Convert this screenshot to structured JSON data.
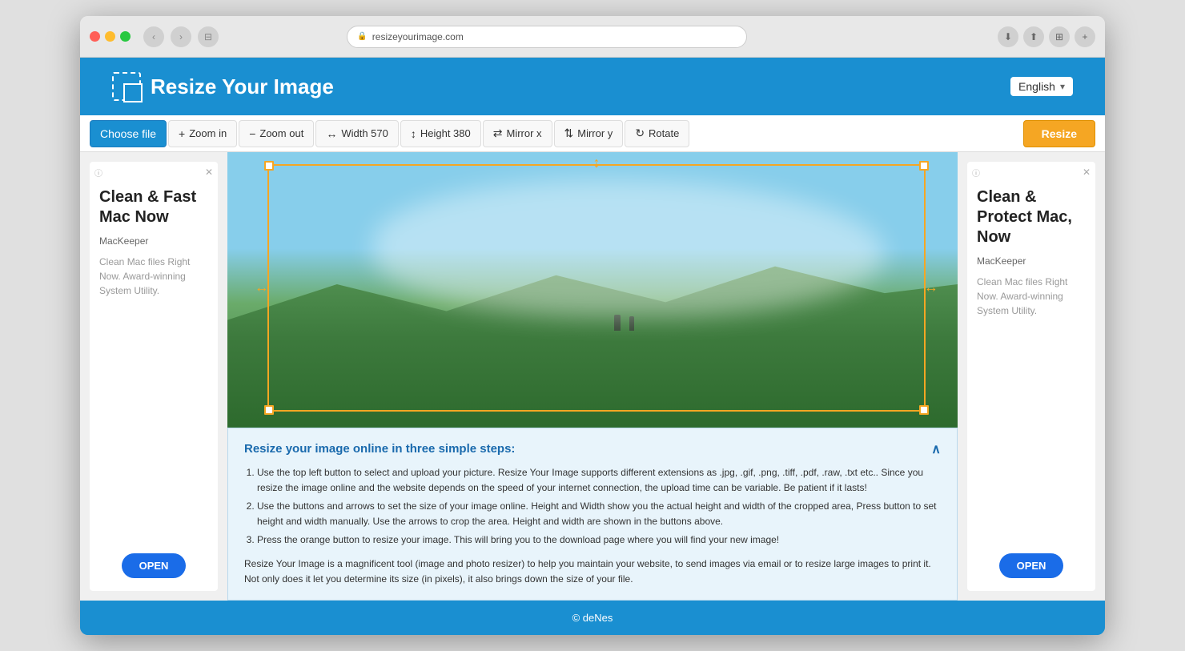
{
  "browser": {
    "url": "resizeyourimage.com",
    "reload_title": "↺"
  },
  "header": {
    "title": "Resize Your Image",
    "lang": "English"
  },
  "toolbar": {
    "choose_label": "Choose file",
    "zoom_in_label": "Zoom in",
    "zoom_out_label": "Zoom out",
    "width_label": "Width 570",
    "height_label": "Height 380",
    "mirror_x_label": "Mirror x",
    "mirror_y_label": "Mirror y",
    "rotate_label": "Rotate",
    "resize_label": "Resize"
  },
  "ad_left": {
    "heading": "Clean & Fast Mac Now",
    "brand": "MacKeeper",
    "desc": "Clean Mac files Right Now. Award-winning System Utility.",
    "open_btn": "OPEN"
  },
  "ad_right": {
    "heading": "Clean & Protect Mac, Now",
    "brand": "MacKeeper",
    "desc": "Clean Mac files Right Now. Award-winning System Utility.",
    "open_btn": "OPEN"
  },
  "info": {
    "title": "Resize your image online in three simple steps:",
    "steps": [
      "Use the top left button to select and upload your picture. Resize Your Image supports different extensions as .jpg, .gif, .png, .tiff, .pdf, .raw, .txt etc.. Since you resize the image online and the website depends on the speed of your internet connection, the upload time can be variable. Be patient if it lasts!",
      "Use the buttons and arrows to set the size of your image online. Height and Width show you the actual height and width of the cropped area, Press button to set height and width manually. Use the arrows to crop the area. Height and width are shown in the buttons above.",
      "Press the orange button to resize your image. This will bring you to the download page where you will find your new image!"
    ],
    "description": "Resize Your Image is a magnificent tool (image and photo resizer) to help you maintain your website, to send images via email or to resize large images to print it. Not only does it let you determine its size (in pixels), it also brings down the size of your file."
  },
  "footer": {
    "copyright": "© deNes"
  }
}
